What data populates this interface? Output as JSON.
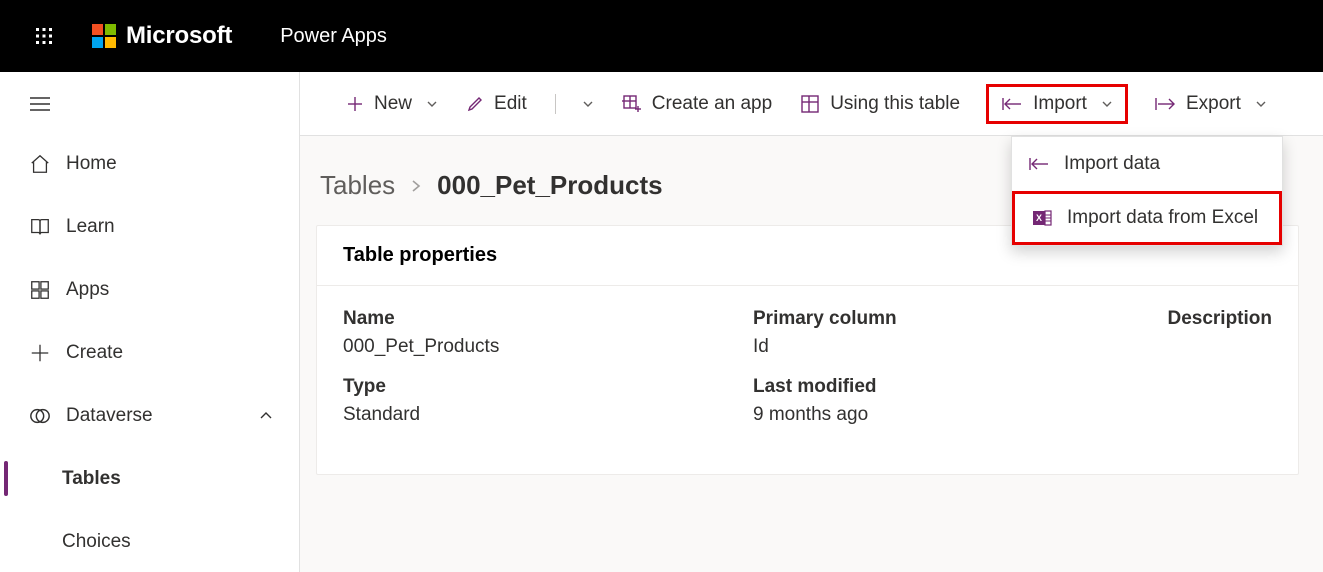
{
  "header": {
    "brand": "Microsoft",
    "app_title": "Power Apps"
  },
  "sidebar": {
    "items": [
      {
        "label": "Home"
      },
      {
        "label": "Learn"
      },
      {
        "label": "Apps"
      },
      {
        "label": "Create"
      },
      {
        "label": "Dataverse"
      },
      {
        "label": "Tables"
      },
      {
        "label": "Choices"
      }
    ]
  },
  "cmdbar": {
    "new_label": "New",
    "edit_label": "Edit",
    "create_app_label": "Create an app",
    "using_table_label": "Using this table",
    "import_label": "Import",
    "export_label": "Export"
  },
  "dropdown": {
    "import_data": "Import data",
    "import_excel": "Import data from Excel"
  },
  "breadcrumb": {
    "parent": "Tables",
    "current": "000_Pet_Products"
  },
  "card": {
    "title": "Table properties",
    "labels": {
      "name": "Name",
      "type": "Type",
      "primary_column": "Primary column",
      "last_modified": "Last modified",
      "description": "Description"
    },
    "values": {
      "name": "000_Pet_Products",
      "type": "Standard",
      "primary_column": "Id",
      "last_modified": "9 months ago",
      "description": ""
    }
  }
}
